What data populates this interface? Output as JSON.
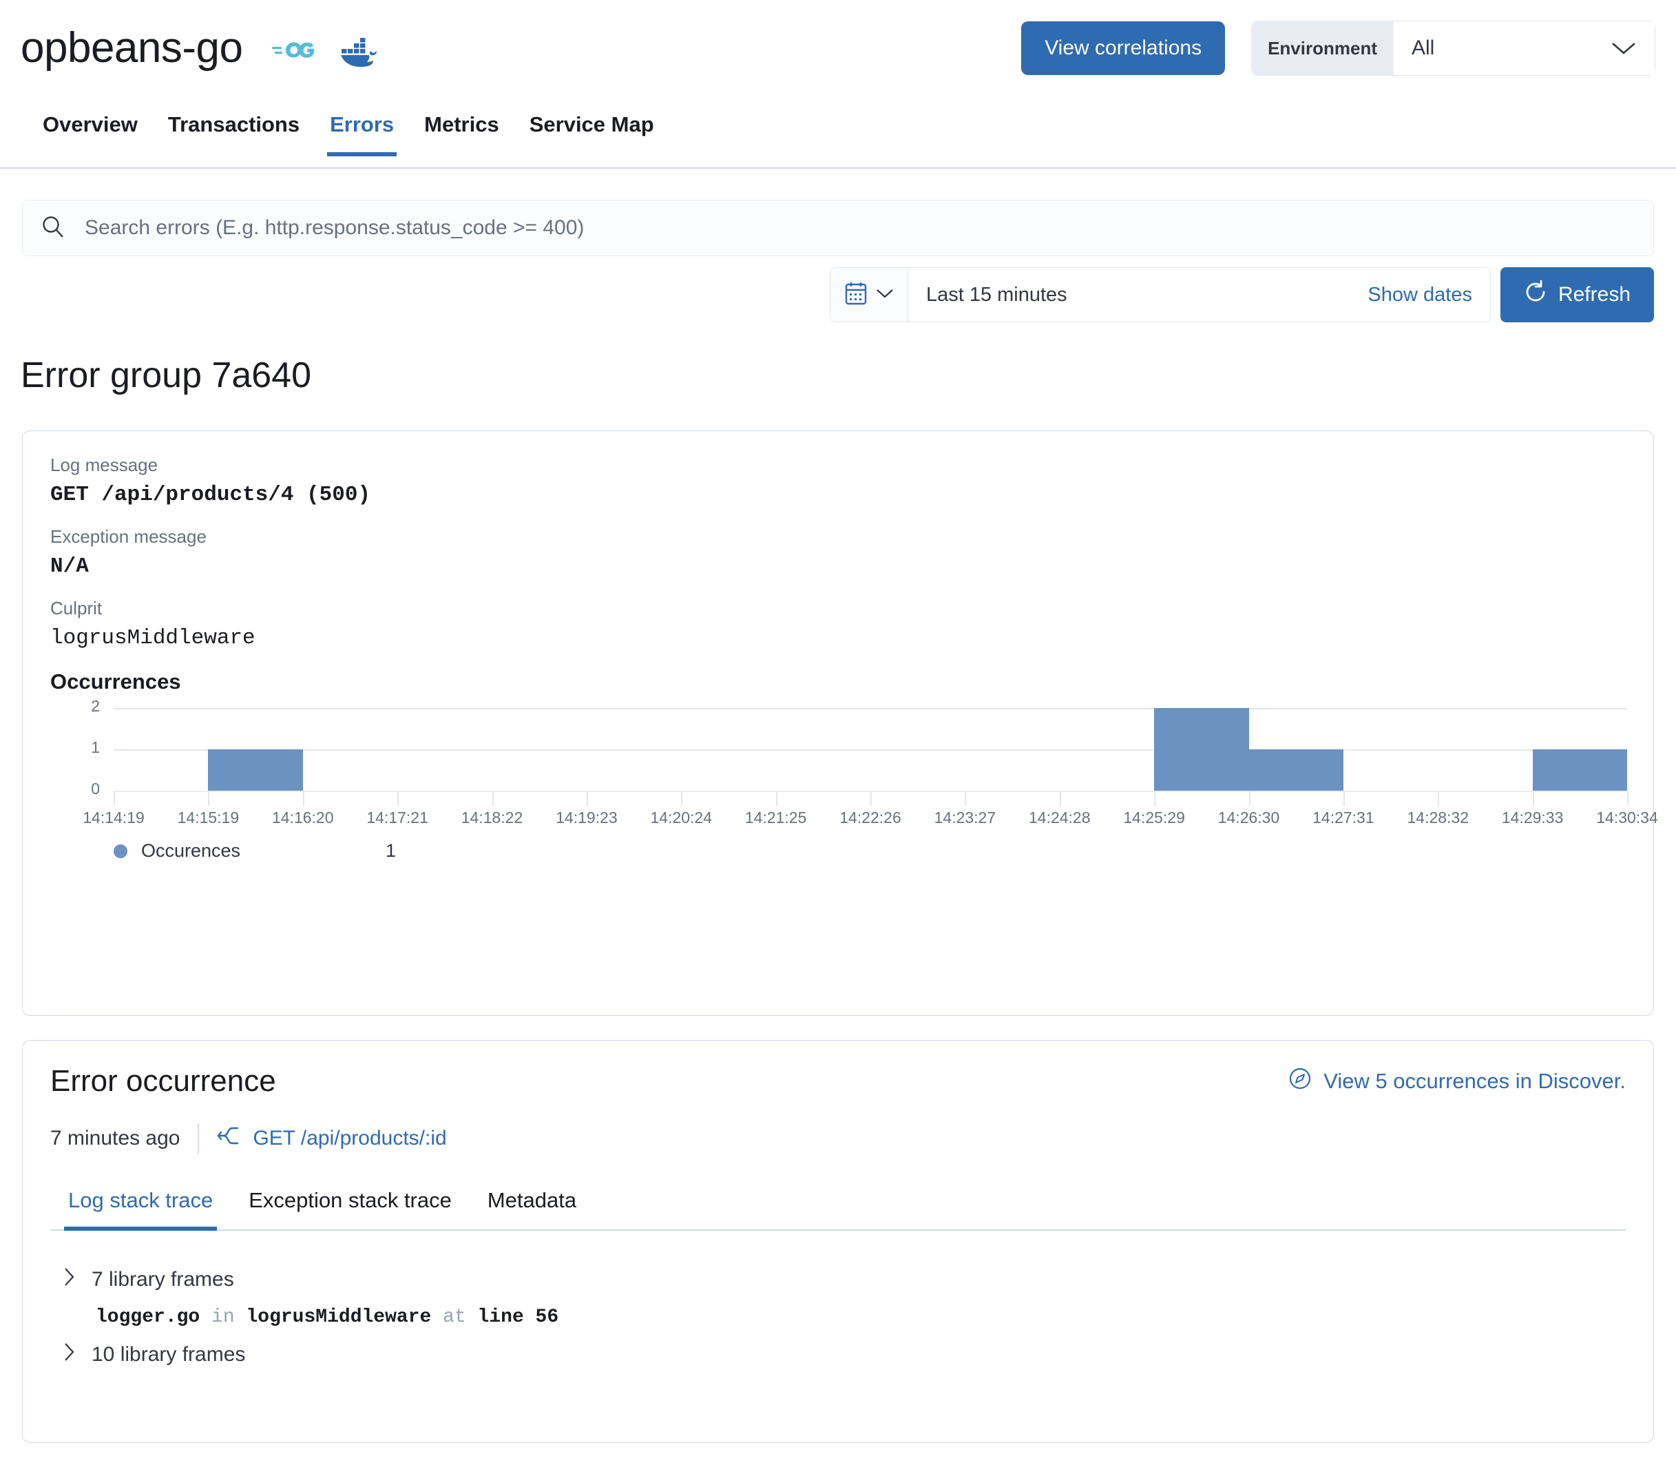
{
  "header": {
    "service_name": "opbeans-go",
    "agent_icon": "go-icon",
    "container_icon": "docker-icon",
    "view_correlations_label": "View correlations",
    "environment_label": "Environment",
    "environment_value": "All"
  },
  "tabs": [
    {
      "label": "Overview",
      "active": false
    },
    {
      "label": "Transactions",
      "active": false
    },
    {
      "label": "Errors",
      "active": true
    },
    {
      "label": "Metrics",
      "active": false
    },
    {
      "label": "Service Map",
      "active": false
    }
  ],
  "search": {
    "placeholder": "Search errors (E.g. http.response.status_code >= 400)",
    "value": ""
  },
  "datepicker": {
    "range_label": "Last 15 minutes",
    "show_dates_label": "Show dates",
    "refresh_label": "Refresh"
  },
  "page_title": "Error group 7a640",
  "details": {
    "log_message_label": "Log message",
    "log_message_value": "GET /api/products/4 (500)",
    "exception_message_label": "Exception message",
    "exception_message_value": "N/A",
    "culprit_label": "Culprit",
    "culprit_value": "logrusMiddleware",
    "occurrences_heading": "Occurrences"
  },
  "chart_data": {
    "type": "bar",
    "title": "Occurrences",
    "xlabel": "",
    "ylabel": "",
    "ylim": [
      0,
      2
    ],
    "yticks": [
      "0",
      "1",
      "2"
    ],
    "grid": true,
    "legend_position": "bottom-left",
    "series_color": "#6b92c0",
    "categories": [
      "14:14:19",
      "14:15:19",
      "14:16:20",
      "14:17:21",
      "14:18:22",
      "14:19:23",
      "14:20:24",
      "14:21:25",
      "14:22:26",
      "14:23:27",
      "14:24:28",
      "14:25:29",
      "14:26:30",
      "14:27:31",
      "14:28:32",
      "14:29:33",
      "14:30:34"
    ],
    "values": [
      0,
      1,
      0,
      0,
      0,
      0,
      0,
      0,
      0,
      0,
      0,
      2,
      1,
      0,
      0,
      1,
      0
    ],
    "legend": [
      {
        "name": "Occurences",
        "value": "1",
        "color": "#6b92c0"
      }
    ]
  },
  "occurrence": {
    "title": "Error occurrence",
    "discover_link": "View 5 occurrences in Discover.",
    "discover_icon": "compass-icon",
    "time_ago": "7 minutes ago",
    "transaction_icon": "merge-icon",
    "transaction_name": "GET /api/products/:id",
    "tabs": [
      {
        "label": "Log stack trace",
        "active": true
      },
      {
        "label": "Exception stack trace",
        "active": false
      },
      {
        "label": "Metadata",
        "active": false
      }
    ],
    "stack": [
      {
        "kind": "toggle",
        "label": "7 library frames"
      },
      {
        "kind": "frame",
        "file": "logger.go",
        "in": "in",
        "fn": "logrusMiddleware",
        "at": "at",
        "line": "line 56"
      },
      {
        "kind": "toggle",
        "label": "10 library frames"
      }
    ]
  }
}
